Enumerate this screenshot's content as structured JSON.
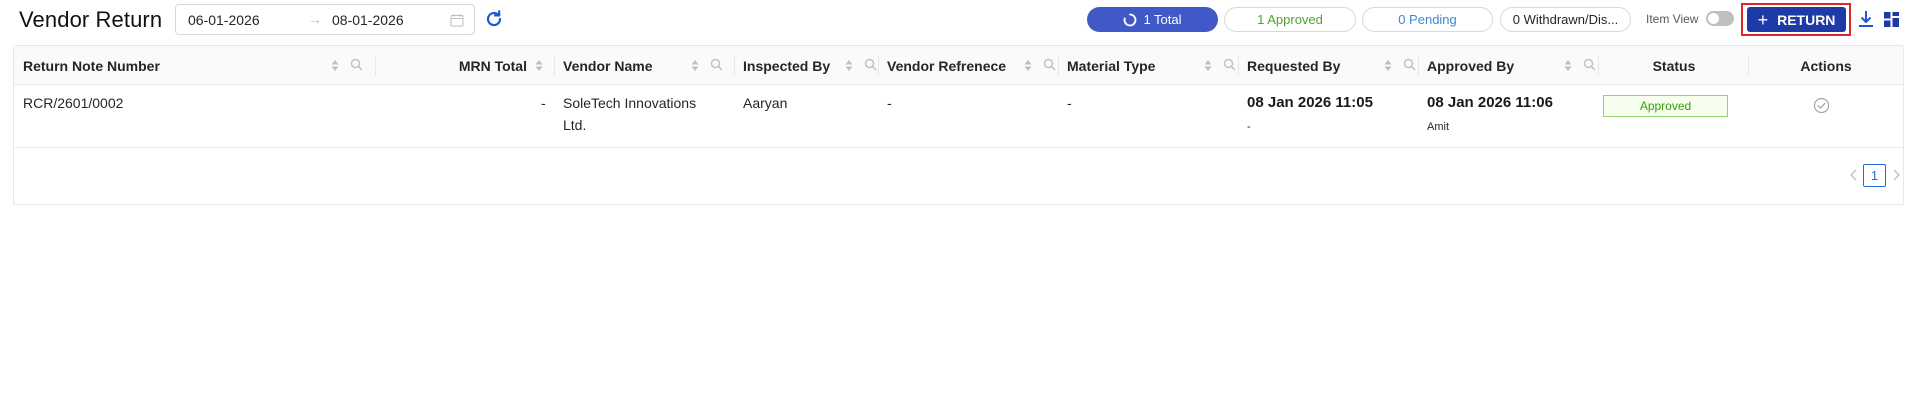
{
  "page": {
    "title": "Vendor Return"
  },
  "date_range": {
    "start": "06-01-2026",
    "end": "08-01-2026",
    "separator": "→"
  },
  "filters": {
    "total": "1 Total",
    "approved": "1 Approved",
    "pending": "0 Pending",
    "withdrawn": "0 Withdrawn/Dis..."
  },
  "toolbar": {
    "item_view_label": "Item View",
    "item_view_on": false,
    "return_label": "RETURN",
    "return_plus": "+"
  },
  "table": {
    "columns": [
      "Return Note Number",
      "MRN Total",
      "Vendor Name",
      "Inspected By",
      "Vendor Refrenece",
      "Material Type",
      "Requested By",
      "Approved By",
      "Status",
      "Actions"
    ],
    "rows": [
      {
        "return_note_number": "RCR/2601/0002",
        "mrn_total": "-",
        "vendor_name_line1": "SoleTech Innovations",
        "vendor_name_line2": "Ltd.",
        "inspected_by": "Aaryan",
        "vendor_reference": "-",
        "material_type": "-",
        "requested_at": "08 Jan 2026 11:05",
        "requested_by": "-",
        "approved_at": "08 Jan 2026 11:06",
        "approved_by": "Amit",
        "status": "Approved"
      }
    ]
  },
  "pagination": {
    "current_page": "1"
  },
  "colors": {
    "primary": "#1e3aa8",
    "total_pill": "#4059c7",
    "approved": "#52a032",
    "pending": "#3b88d9",
    "highlight": "#e0262a"
  },
  "icons": {
    "calendar": "calendar-icon",
    "refresh": "refresh-icon",
    "spinner": "loading-icon",
    "download": "download-icon",
    "layout": "grid-layout-icon",
    "sort": "sort-icon",
    "search": "search-icon",
    "action": "check-circle-icon"
  }
}
